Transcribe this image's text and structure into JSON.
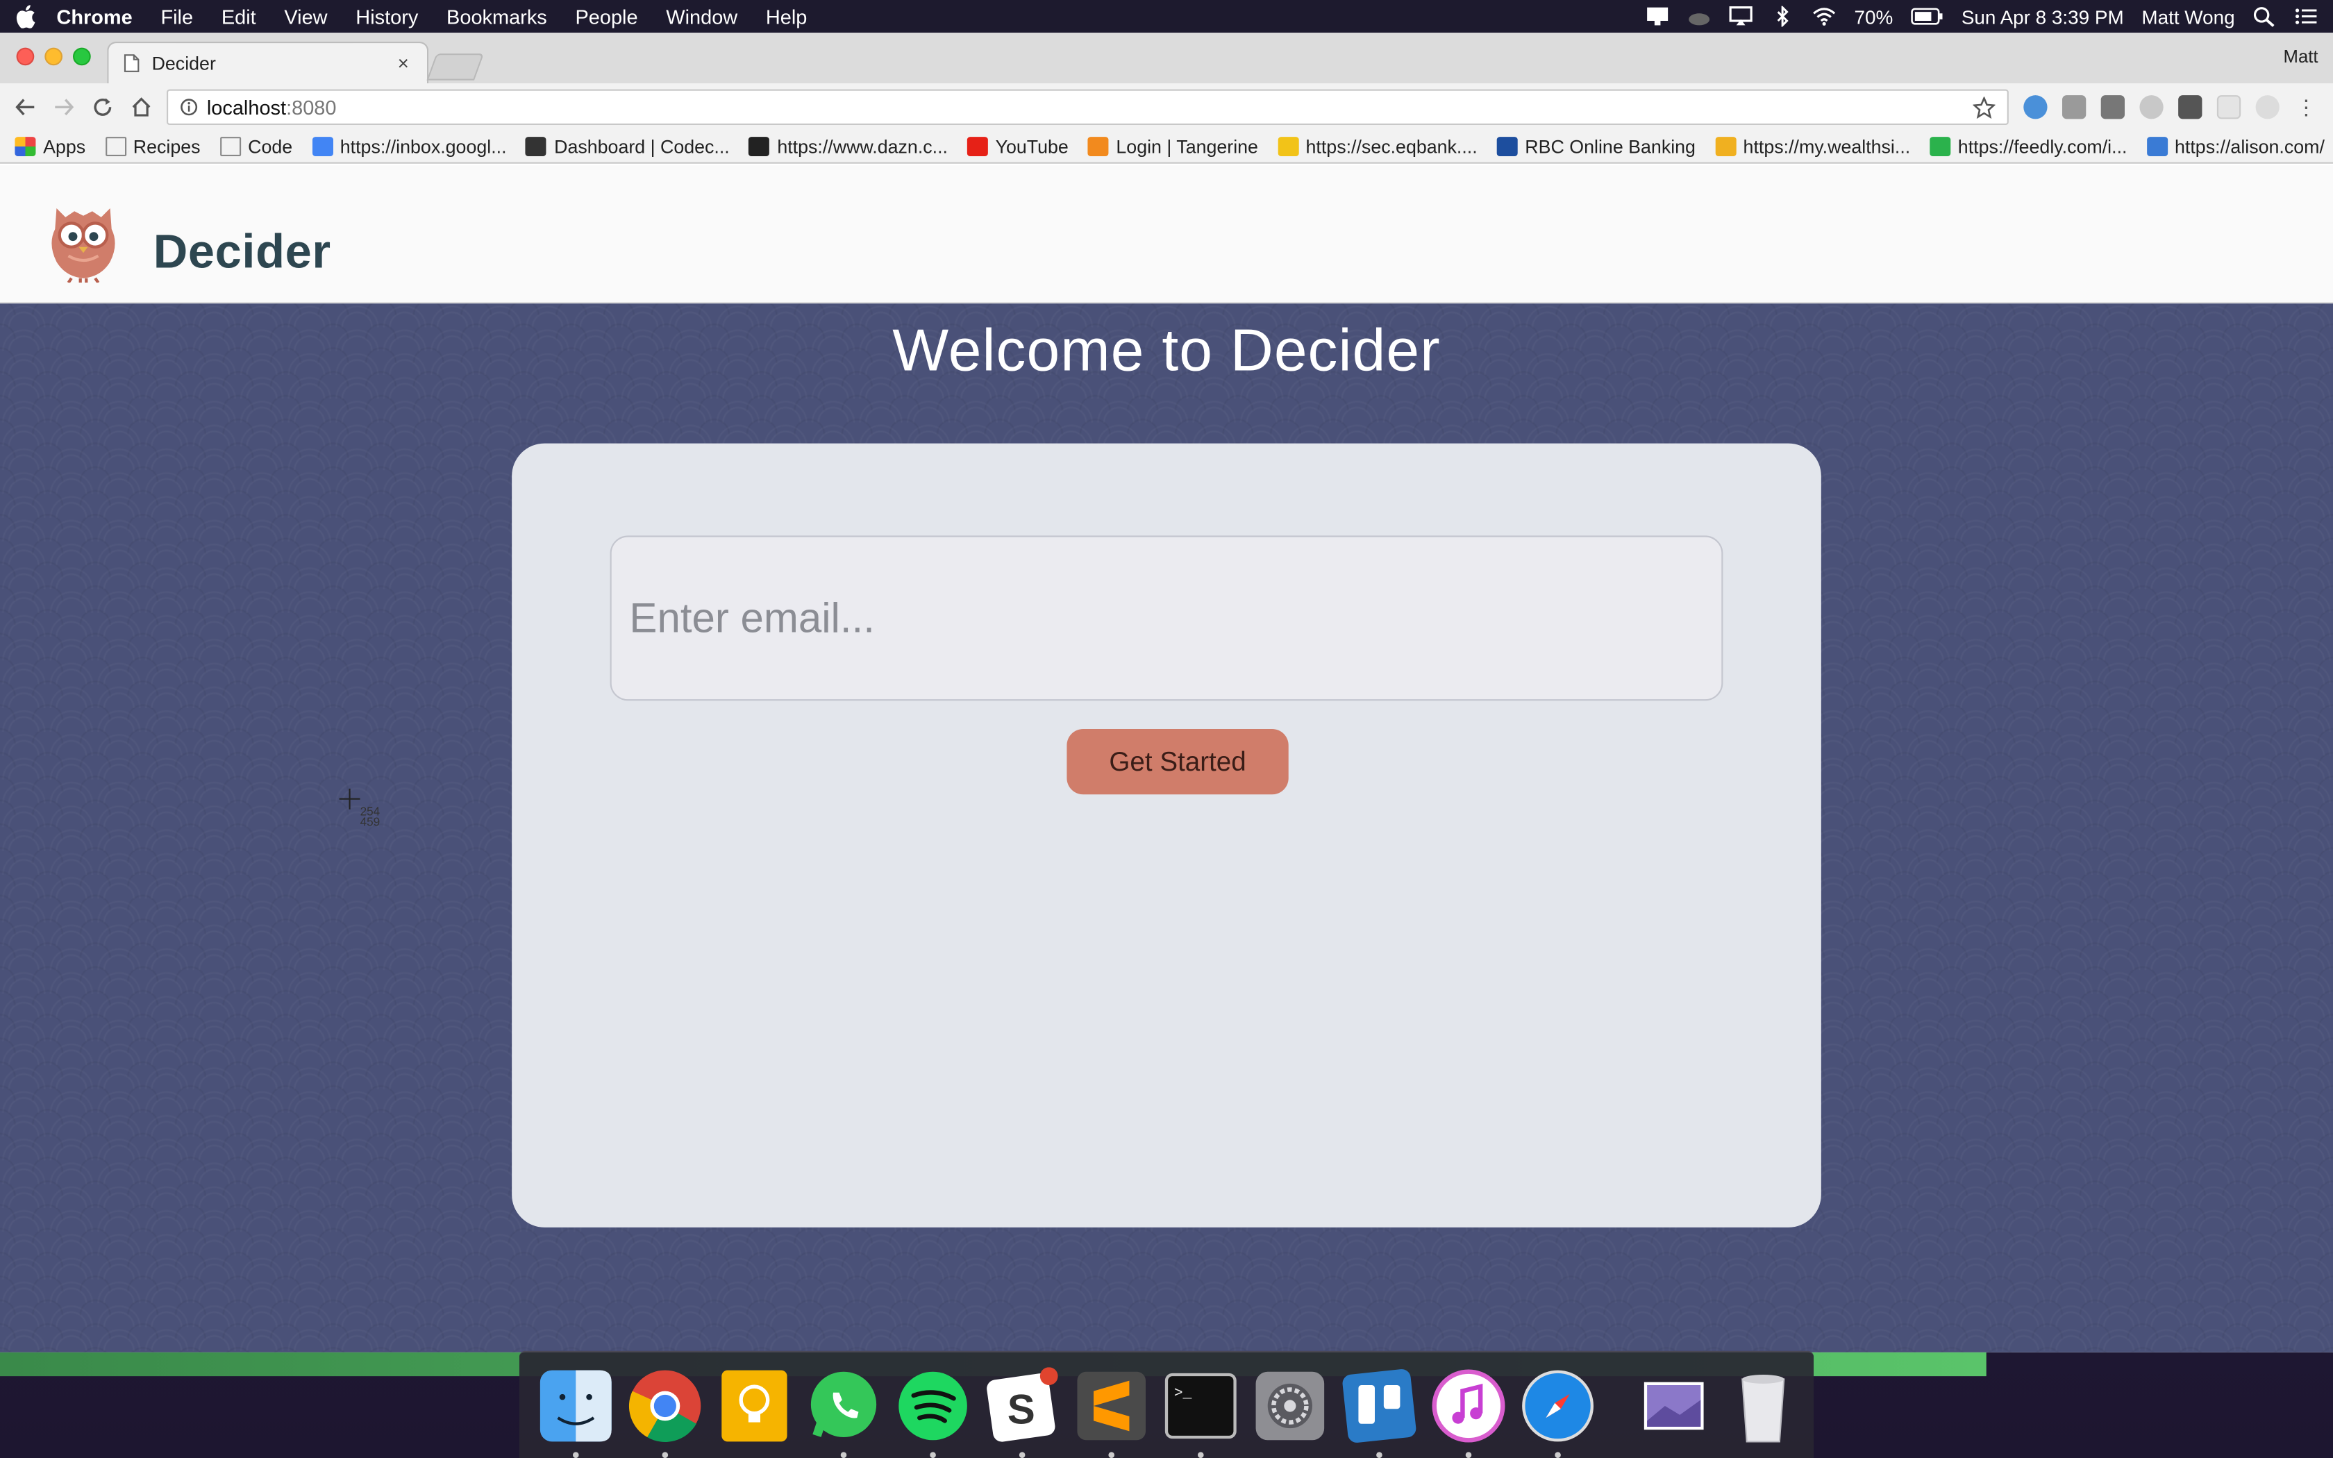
{
  "menubar": {
    "app_name": "Chrome",
    "items": [
      "File",
      "Edit",
      "View",
      "History",
      "Bookmarks",
      "People",
      "Window",
      "Help"
    ],
    "battery": "70%",
    "datetime": "Sun Apr 8  3:39 PM",
    "user": "Matt Wong"
  },
  "browser": {
    "tab_title": "Decider",
    "tab_close": "×",
    "profile_name": "Matt",
    "url_host": "localhost",
    "url_port": ":8080",
    "bookmarks": [
      {
        "label": "Apps",
        "icon": "apps-grid-icon",
        "color": "#e44"
      },
      {
        "label": "Recipes",
        "icon": "folder-icon",
        "color": "#888"
      },
      {
        "label": "Code",
        "icon": "folder-icon",
        "color": "#888"
      },
      {
        "label": "https://inbox.googl...",
        "icon": "inbox-icon",
        "color": "#4285f4"
      },
      {
        "label": "Dashboard | Codec...",
        "icon": "codecademy-icon",
        "color": "#333"
      },
      {
        "label": "https://www.dazn.c...",
        "icon": "dazn-icon",
        "color": "#222"
      },
      {
        "label": "YouTube",
        "icon": "youtube-icon",
        "color": "#e62117"
      },
      {
        "label": "Login | Tangerine",
        "icon": "tangerine-icon",
        "color": "#f28a1e"
      },
      {
        "label": "https://sec.eqbank....",
        "icon": "eqbank-icon",
        "color": "#f2c318"
      },
      {
        "label": "RBC Online Banking",
        "icon": "rbc-icon",
        "color": "#1d4e9e"
      },
      {
        "label": "https://my.wealthsi...",
        "icon": "wealthsimple-icon",
        "color": "#f0b020"
      },
      {
        "label": "https://feedly.com/i...",
        "icon": "feedly-icon",
        "color": "#2bb24c"
      },
      {
        "label": "https://alison.com/",
        "icon": "alison-icon",
        "color": "#3a7bd5"
      }
    ],
    "bookmarks_more": "»"
  },
  "app": {
    "brand": "Decider",
    "welcome": "Welcome to Decider",
    "email_placeholder": "Enter email...",
    "email_value": "",
    "cta_label": "Get Started"
  },
  "cursor_readout": {
    "x": "254",
    "y": "459"
  },
  "colors": {
    "brand_text": "#2d4650",
    "accent": "#d07d6a",
    "hero_bg": "#4a5178",
    "card_bg": "#e3e6ec"
  },
  "dock": {
    "apps": [
      "finder-icon",
      "chrome-icon",
      "keep-icon",
      "whatsapp-icon",
      "spotify-icon",
      "slack-icon",
      "sublime-icon",
      "terminal-icon",
      "system-preferences-icon",
      "trello-icon",
      "itunes-icon",
      "safari-icon"
    ],
    "extras": [
      "downloads-stack-icon",
      "trash-icon"
    ]
  }
}
